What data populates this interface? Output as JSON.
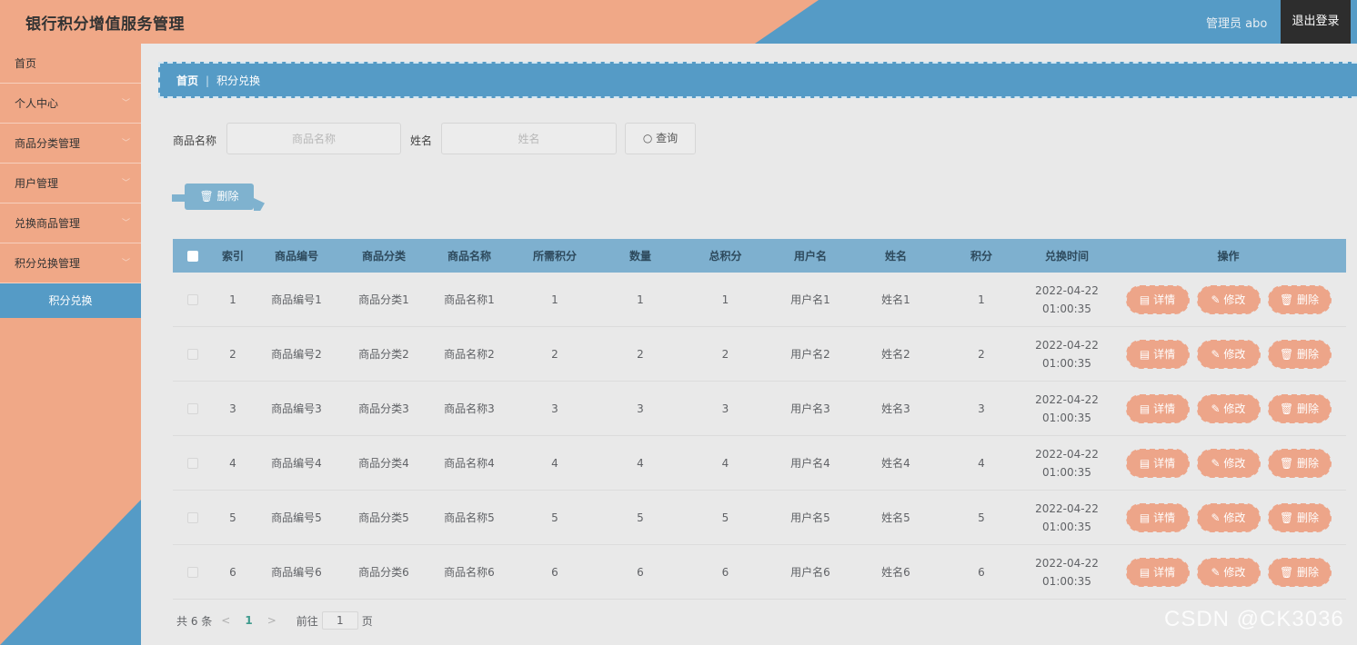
{
  "header": {
    "title": "银行积分增值服务管理",
    "admin": "管理员 abo",
    "logout": "退出登录"
  },
  "sidebar": {
    "items": [
      {
        "label": "首页",
        "has_chevron": false
      },
      {
        "label": "个人中心",
        "has_chevron": true
      },
      {
        "label": "商品分类管理",
        "has_chevron": true
      },
      {
        "label": "用户管理",
        "has_chevron": true
      },
      {
        "label": "兑换商品管理",
        "has_chevron": true
      },
      {
        "label": "积分兑换管理",
        "has_chevron": true
      }
    ],
    "active_sub": "积分兑换"
  },
  "breadcrumb": {
    "home": "首页",
    "separator": "|",
    "current": "积分兑换"
  },
  "search": {
    "product_label": "商品名称",
    "product_placeholder": "商品名称",
    "name_label": "姓名",
    "name_placeholder": "姓名",
    "query_icon": "search-icon",
    "query_label": "查询"
  },
  "batch_delete": {
    "icon": "trash-icon",
    "label": "删除"
  },
  "table": {
    "headers": [
      "索引",
      "商品编号",
      "商品分类",
      "商品名称",
      "所需积分",
      "数量",
      "总积分",
      "用户名",
      "姓名",
      "积分",
      "兑换时间",
      "操作"
    ],
    "rows": [
      {
        "index": "1",
        "code": "商品编号1",
        "category": "商品分类1",
        "product": "商品名称1",
        "required": "1",
        "qty": "1",
        "total": "1",
        "username": "用户名1",
        "name": "姓名1",
        "points": "1",
        "date": "2022-04-22",
        "time": "01:00:35"
      },
      {
        "index": "2",
        "code": "商品编号2",
        "category": "商品分类2",
        "product": "商品名称2",
        "required": "2",
        "qty": "2",
        "total": "2",
        "username": "用户名2",
        "name": "姓名2",
        "points": "2",
        "date": "2022-04-22",
        "time": "01:00:35"
      },
      {
        "index": "3",
        "code": "商品编号3",
        "category": "商品分类3",
        "product": "商品名称3",
        "required": "3",
        "qty": "3",
        "total": "3",
        "username": "用户名3",
        "name": "姓名3",
        "points": "3",
        "date": "2022-04-22",
        "time": "01:00:35"
      },
      {
        "index": "4",
        "code": "商品编号4",
        "category": "商品分类4",
        "product": "商品名称4",
        "required": "4",
        "qty": "4",
        "total": "4",
        "username": "用户名4",
        "name": "姓名4",
        "points": "4",
        "date": "2022-04-22",
        "time": "01:00:35"
      },
      {
        "index": "5",
        "code": "商品编号5",
        "category": "商品分类5",
        "product": "商品名称5",
        "required": "5",
        "qty": "5",
        "total": "5",
        "username": "用户名5",
        "name": "姓名5",
        "points": "5",
        "date": "2022-04-22",
        "time": "01:00:35"
      },
      {
        "index": "6",
        "code": "商品编号6",
        "category": "商品分类6",
        "product": "商品名称6",
        "required": "6",
        "qty": "6",
        "total": "6",
        "username": "用户名6",
        "name": "姓名6",
        "points": "6",
        "date": "2022-04-22",
        "time": "01:00:35"
      }
    ],
    "actions": {
      "detail": "详情",
      "edit": "修改",
      "delete": "删除"
    }
  },
  "pagination": {
    "total": "共 6 条",
    "current_page": "1",
    "goto_prefix": "前往",
    "goto_value": "1",
    "goto_suffix": "页"
  },
  "watermark": "CSDN @CK3036",
  "colors": {
    "peach": "#f0a887",
    "blue": "#559bc6",
    "table_header": "#7eb0cf",
    "action_button": "#eda589"
  }
}
